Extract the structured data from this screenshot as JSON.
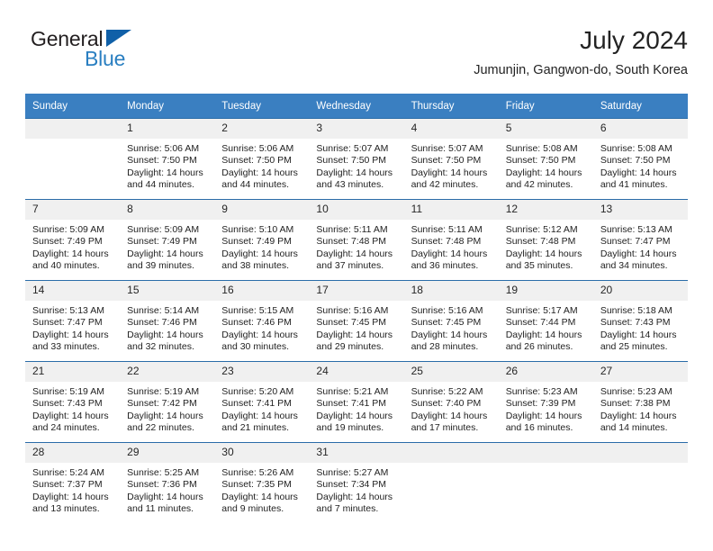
{
  "brand": {
    "word1": "General",
    "word2": "Blue",
    "triangle_color": "#1060a8",
    "blue_text_color": "#2a7fc1"
  },
  "header": {
    "title": "July 2024",
    "subtitle": "Jumunjin, Gangwon-do, South Korea"
  },
  "theme": {
    "header_bg": "#3a7fc1",
    "row_divider": "#2a6ca8",
    "daynum_bg": "#f0f0f0"
  },
  "calendar": {
    "weekday_headers": [
      "Sunday",
      "Monday",
      "Tuesday",
      "Wednesday",
      "Thursday",
      "Friday",
      "Saturday"
    ],
    "weeks": [
      [
        {
          "day": ""
        },
        {
          "day": "1",
          "sunrise": "Sunrise: 5:06 AM",
          "sunset": "Sunset: 7:50 PM",
          "daylight_line1": "Daylight: 14 hours",
          "daylight_line2": "and 44 minutes."
        },
        {
          "day": "2",
          "sunrise": "Sunrise: 5:06 AM",
          "sunset": "Sunset: 7:50 PM",
          "daylight_line1": "Daylight: 14 hours",
          "daylight_line2": "and 44 minutes."
        },
        {
          "day": "3",
          "sunrise": "Sunrise: 5:07 AM",
          "sunset": "Sunset: 7:50 PM",
          "daylight_line1": "Daylight: 14 hours",
          "daylight_line2": "and 43 minutes."
        },
        {
          "day": "4",
          "sunrise": "Sunrise: 5:07 AM",
          "sunset": "Sunset: 7:50 PM",
          "daylight_line1": "Daylight: 14 hours",
          "daylight_line2": "and 42 minutes."
        },
        {
          "day": "5",
          "sunrise": "Sunrise: 5:08 AM",
          "sunset": "Sunset: 7:50 PM",
          "daylight_line1": "Daylight: 14 hours",
          "daylight_line2": "and 42 minutes."
        },
        {
          "day": "6",
          "sunrise": "Sunrise: 5:08 AM",
          "sunset": "Sunset: 7:50 PM",
          "daylight_line1": "Daylight: 14 hours",
          "daylight_line2": "and 41 minutes."
        }
      ],
      [
        {
          "day": "7",
          "sunrise": "Sunrise: 5:09 AM",
          "sunset": "Sunset: 7:49 PM",
          "daylight_line1": "Daylight: 14 hours",
          "daylight_line2": "and 40 minutes."
        },
        {
          "day": "8",
          "sunrise": "Sunrise: 5:09 AM",
          "sunset": "Sunset: 7:49 PM",
          "daylight_line1": "Daylight: 14 hours",
          "daylight_line2": "and 39 minutes."
        },
        {
          "day": "9",
          "sunrise": "Sunrise: 5:10 AM",
          "sunset": "Sunset: 7:49 PM",
          "daylight_line1": "Daylight: 14 hours",
          "daylight_line2": "and 38 minutes."
        },
        {
          "day": "10",
          "sunrise": "Sunrise: 5:11 AM",
          "sunset": "Sunset: 7:48 PM",
          "daylight_line1": "Daylight: 14 hours",
          "daylight_line2": "and 37 minutes."
        },
        {
          "day": "11",
          "sunrise": "Sunrise: 5:11 AM",
          "sunset": "Sunset: 7:48 PM",
          "daylight_line1": "Daylight: 14 hours",
          "daylight_line2": "and 36 minutes."
        },
        {
          "day": "12",
          "sunrise": "Sunrise: 5:12 AM",
          "sunset": "Sunset: 7:48 PM",
          "daylight_line1": "Daylight: 14 hours",
          "daylight_line2": "and 35 minutes."
        },
        {
          "day": "13",
          "sunrise": "Sunrise: 5:13 AM",
          "sunset": "Sunset: 7:47 PM",
          "daylight_line1": "Daylight: 14 hours",
          "daylight_line2": "and 34 minutes."
        }
      ],
      [
        {
          "day": "14",
          "sunrise": "Sunrise: 5:13 AM",
          "sunset": "Sunset: 7:47 PM",
          "daylight_line1": "Daylight: 14 hours",
          "daylight_line2": "and 33 minutes."
        },
        {
          "day": "15",
          "sunrise": "Sunrise: 5:14 AM",
          "sunset": "Sunset: 7:46 PM",
          "daylight_line1": "Daylight: 14 hours",
          "daylight_line2": "and 32 minutes."
        },
        {
          "day": "16",
          "sunrise": "Sunrise: 5:15 AM",
          "sunset": "Sunset: 7:46 PM",
          "daylight_line1": "Daylight: 14 hours",
          "daylight_line2": "and 30 minutes."
        },
        {
          "day": "17",
          "sunrise": "Sunrise: 5:16 AM",
          "sunset": "Sunset: 7:45 PM",
          "daylight_line1": "Daylight: 14 hours",
          "daylight_line2": "and 29 minutes."
        },
        {
          "day": "18",
          "sunrise": "Sunrise: 5:16 AM",
          "sunset": "Sunset: 7:45 PM",
          "daylight_line1": "Daylight: 14 hours",
          "daylight_line2": "and 28 minutes."
        },
        {
          "day": "19",
          "sunrise": "Sunrise: 5:17 AM",
          "sunset": "Sunset: 7:44 PM",
          "daylight_line1": "Daylight: 14 hours",
          "daylight_line2": "and 26 minutes."
        },
        {
          "day": "20",
          "sunrise": "Sunrise: 5:18 AM",
          "sunset": "Sunset: 7:43 PM",
          "daylight_line1": "Daylight: 14 hours",
          "daylight_line2": "and 25 minutes."
        }
      ],
      [
        {
          "day": "21",
          "sunrise": "Sunrise: 5:19 AM",
          "sunset": "Sunset: 7:43 PM",
          "daylight_line1": "Daylight: 14 hours",
          "daylight_line2": "and 24 minutes."
        },
        {
          "day": "22",
          "sunrise": "Sunrise: 5:19 AM",
          "sunset": "Sunset: 7:42 PM",
          "daylight_line1": "Daylight: 14 hours",
          "daylight_line2": "and 22 minutes."
        },
        {
          "day": "23",
          "sunrise": "Sunrise: 5:20 AM",
          "sunset": "Sunset: 7:41 PM",
          "daylight_line1": "Daylight: 14 hours",
          "daylight_line2": "and 21 minutes."
        },
        {
          "day": "24",
          "sunrise": "Sunrise: 5:21 AM",
          "sunset": "Sunset: 7:41 PM",
          "daylight_line1": "Daylight: 14 hours",
          "daylight_line2": "and 19 minutes."
        },
        {
          "day": "25",
          "sunrise": "Sunrise: 5:22 AM",
          "sunset": "Sunset: 7:40 PM",
          "daylight_line1": "Daylight: 14 hours",
          "daylight_line2": "and 17 minutes."
        },
        {
          "day": "26",
          "sunrise": "Sunrise: 5:23 AM",
          "sunset": "Sunset: 7:39 PM",
          "daylight_line1": "Daylight: 14 hours",
          "daylight_line2": "and 16 minutes."
        },
        {
          "day": "27",
          "sunrise": "Sunrise: 5:23 AM",
          "sunset": "Sunset: 7:38 PM",
          "daylight_line1": "Daylight: 14 hours",
          "daylight_line2": "and 14 minutes."
        }
      ],
      [
        {
          "day": "28",
          "sunrise": "Sunrise: 5:24 AM",
          "sunset": "Sunset: 7:37 PM",
          "daylight_line1": "Daylight: 14 hours",
          "daylight_line2": "and 13 minutes."
        },
        {
          "day": "29",
          "sunrise": "Sunrise: 5:25 AM",
          "sunset": "Sunset: 7:36 PM",
          "daylight_line1": "Daylight: 14 hours",
          "daylight_line2": "and 11 minutes."
        },
        {
          "day": "30",
          "sunrise": "Sunrise: 5:26 AM",
          "sunset": "Sunset: 7:35 PM",
          "daylight_line1": "Daylight: 14 hours",
          "daylight_line2": "and 9 minutes."
        },
        {
          "day": "31",
          "sunrise": "Sunrise: 5:27 AM",
          "sunset": "Sunset: 7:34 PM",
          "daylight_line1": "Daylight: 14 hours",
          "daylight_line2": "and 7 minutes."
        },
        {
          "day": ""
        },
        {
          "day": ""
        },
        {
          "day": ""
        }
      ]
    ]
  }
}
